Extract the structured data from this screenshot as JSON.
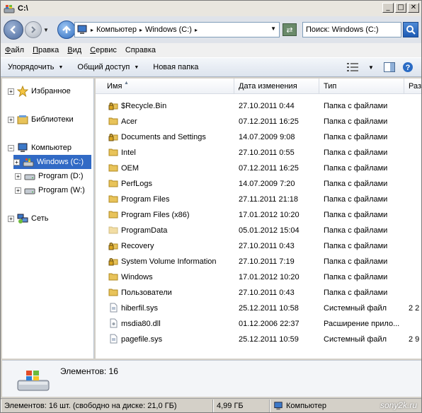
{
  "window": {
    "title": "C:\\"
  },
  "titlebar_buttons": {
    "minimize": "_",
    "maximize": "□",
    "close": "✕"
  },
  "address": {
    "crumbs": [
      "Компьютер",
      "Windows (C:)"
    ],
    "search_placeholder": "Поиск: Windows (C:)"
  },
  "menu": [
    "Файл",
    "Правка",
    "Вид",
    "Сервис",
    "Справка"
  ],
  "menu_underline": [
    "Ф",
    "П",
    "В",
    "С",
    "С"
  ],
  "menu_rest": [
    "айл",
    "равка",
    "ид",
    "ервис",
    "правка"
  ],
  "commands": {
    "organize": "Упорядочить",
    "share": "Общий доступ",
    "new_folder": "Новая папка"
  },
  "nav": {
    "favorites": "Избранное",
    "libraries": "Библиотеки",
    "computer": "Компьютер",
    "drive_c": "Windows (C:)",
    "drive_d": "Program (D:)",
    "drive_w": "Program (W:)",
    "network": "Сеть"
  },
  "columns": {
    "name": "Имя",
    "date": "Дата изменения",
    "type": "Тип",
    "size": "Раз"
  },
  "files": [
    {
      "name": "$Recycle.Bin",
      "date": "27.10.2011 0:44",
      "type": "Папка с файлами",
      "size": "",
      "icon": "locked-folder"
    },
    {
      "name": "Acer",
      "date": "07.12.2011 16:25",
      "type": "Папка с файлами",
      "size": "",
      "icon": "folder"
    },
    {
      "name": "Documents and Settings",
      "date": "14.07.2009 9:08",
      "type": "Папка с файлами",
      "size": "",
      "icon": "locked-folder"
    },
    {
      "name": "Intel",
      "date": "27.10.2011 0:55",
      "type": "Папка с файлами",
      "size": "",
      "icon": "folder"
    },
    {
      "name": "OEM",
      "date": "07.12.2011 16:25",
      "type": "Папка с файлами",
      "size": "",
      "icon": "folder"
    },
    {
      "name": "PerfLogs",
      "date": "14.07.2009 7:20",
      "type": "Папка с файлами",
      "size": "",
      "icon": "folder"
    },
    {
      "name": "Program Files",
      "date": "27.11.2011 21:18",
      "type": "Папка с файлами",
      "size": "",
      "icon": "folder"
    },
    {
      "name": "Program Files (x86)",
      "date": "17.01.2012 10:20",
      "type": "Папка с файлами",
      "size": "",
      "icon": "folder"
    },
    {
      "name": "ProgramData",
      "date": "05.01.2012 15:04",
      "type": "Папка с файлами",
      "size": "",
      "icon": "hidden-folder"
    },
    {
      "name": "Recovery",
      "date": "27.10.2011 0:43",
      "type": "Папка с файлами",
      "size": "",
      "icon": "locked-folder"
    },
    {
      "name": "System Volume Information",
      "date": "27.10.2011 7:19",
      "type": "Папка с файлами",
      "size": "",
      "icon": "locked-folder"
    },
    {
      "name": "Windows",
      "date": "17.01.2012 10:20",
      "type": "Папка с файлами",
      "size": "",
      "icon": "folder"
    },
    {
      "name": "Пользователи",
      "date": "27.10.2011 0:43",
      "type": "Папка с файлами",
      "size": "",
      "icon": "folder"
    },
    {
      "name": "hiberfil.sys",
      "date": "25.12.2011 10:58",
      "type": "Системный файл",
      "size": "2 2",
      "icon": "system-file"
    },
    {
      "name": "msdia80.dll",
      "date": "01.12.2006 22:37",
      "type": "Расширение прило...",
      "size": "",
      "icon": "dll-file"
    },
    {
      "name": "pagefile.sys",
      "date": "25.12.2011 10:59",
      "type": "Системный файл",
      "size": "2 9",
      "icon": "system-file"
    }
  ],
  "details": {
    "count": "Элементов: 16"
  },
  "status": {
    "items": "Элементов: 16 шт. (свободно на диске: 21,0 ГБ)",
    "size": "4,99 ГБ",
    "location": "Компьютер"
  },
  "watermark": "sony2k.ru",
  "colors": {
    "selection": "#316ac5",
    "folder": "#e8c35a",
    "accent": "#1d5bb4"
  }
}
